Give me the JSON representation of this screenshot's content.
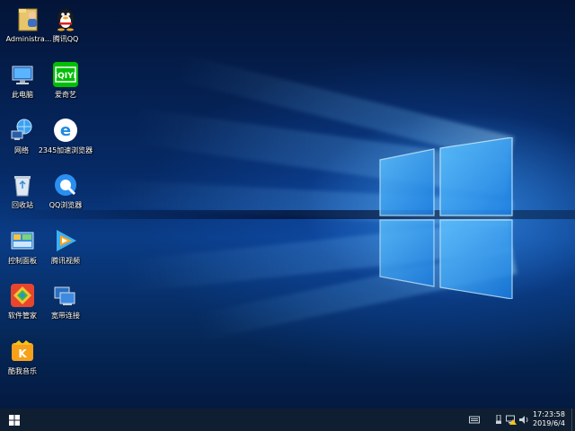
{
  "desktop": {
    "icons": [
      {
        "label": "Administra...",
        "icon": "user-folder-icon"
      },
      {
        "label": "腾讯QQ",
        "icon": "qq-penguin-icon"
      },
      {
        "label": "此电脑",
        "icon": "computer-icon"
      },
      {
        "label": "爱奇艺",
        "icon": "iqiyi-icon"
      },
      {
        "label": "网络",
        "icon": "network-icon"
      },
      {
        "label": "2345加速浏览器",
        "icon": "browser-2345-icon"
      },
      {
        "label": "回收站",
        "icon": "recycle-bin-icon"
      },
      {
        "label": "QQ浏览器",
        "icon": "qq-browser-icon"
      },
      {
        "label": "控制面板",
        "icon": "control-panel-icon"
      },
      {
        "label": "腾讯视频",
        "icon": "tencent-video-icon"
      },
      {
        "label": "软件管家",
        "icon": "software-manager-icon"
      },
      {
        "label": "宽带连接",
        "icon": "broadband-connection-icon"
      },
      {
        "label": "酷我音乐",
        "icon": "kuwo-music-icon"
      }
    ]
  },
  "taskbar": {
    "clock_time": "17:23:58",
    "clock_date": "2019/6/4"
  },
  "colors": {
    "taskbar": "#0f1e30",
    "accent": "#1e90ff"
  }
}
